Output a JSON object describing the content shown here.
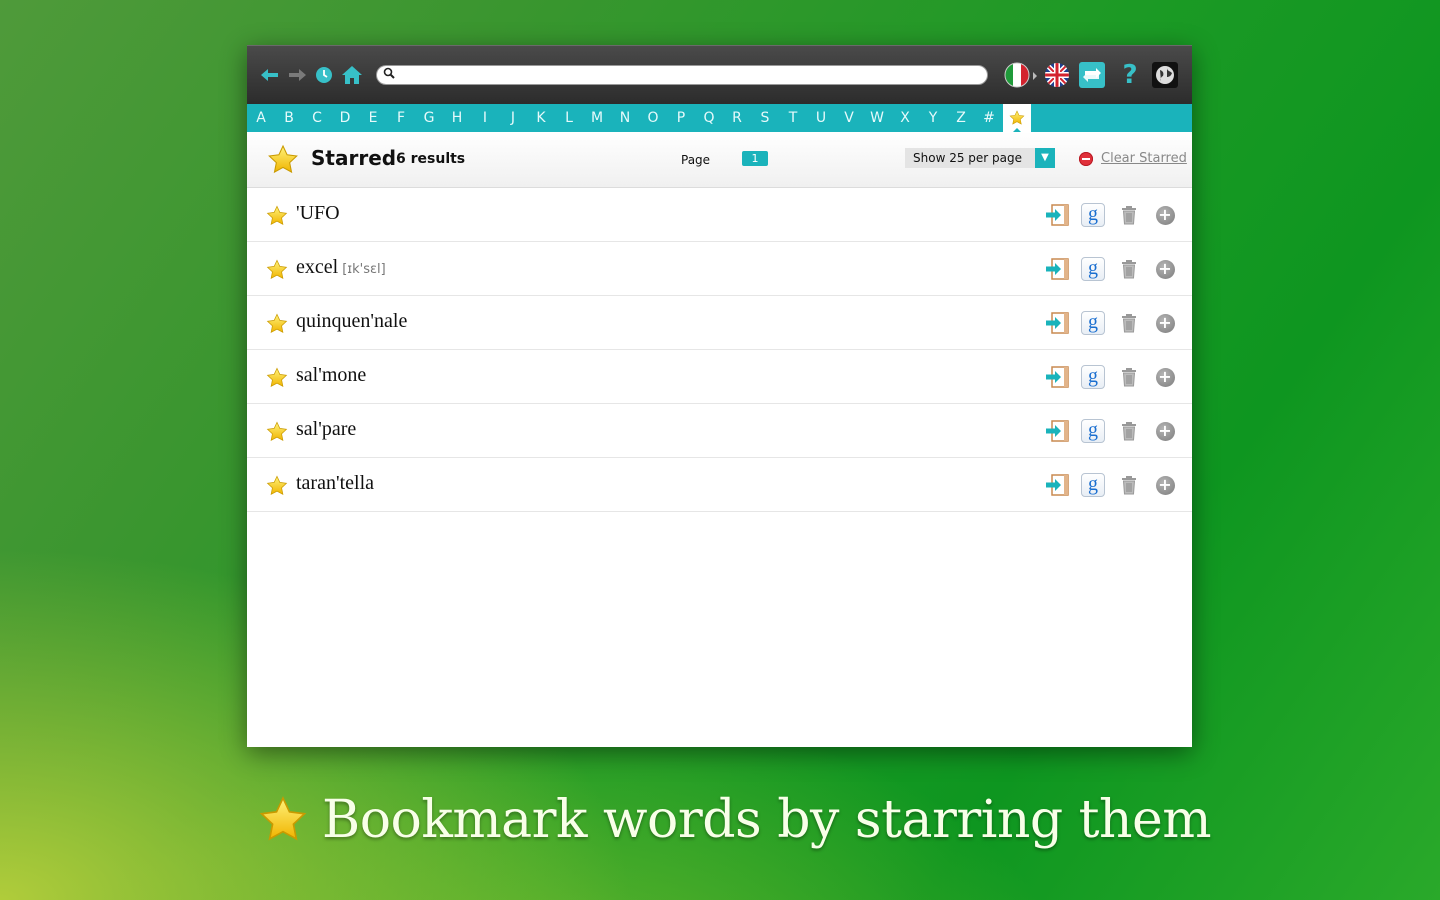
{
  "toolbar": {
    "search": {
      "value": "",
      "placeholder": ""
    },
    "icons": [
      "back-arrow-icon",
      "forward-arrow-icon",
      "history-clock-icon",
      "home-icon",
      "search-icon",
      "italian-flag-icon",
      "uk-flag-icon",
      "swap-languages-icon",
      "help-icon",
      "globe-icon"
    ]
  },
  "alphabet": [
    "A",
    "B",
    "C",
    "D",
    "E",
    "F",
    "G",
    "H",
    "I",
    "J",
    "K",
    "L",
    "M",
    "N",
    "O",
    "P",
    "Q",
    "R",
    "S",
    "T",
    "U",
    "V",
    "W",
    "X",
    "Y",
    "Z",
    "#"
  ],
  "header": {
    "title": "Starred",
    "results": "6 results",
    "page_label": "Page",
    "page_number": "1",
    "per_page": "Show 25 per page",
    "clear_label": "Clear Starred"
  },
  "words": [
    {
      "word": "'UFO",
      "ipa": ""
    },
    {
      "word": "excel",
      "ipa": "[ɪk'sɛl]"
    },
    {
      "word": "quinquen'nale",
      "ipa": ""
    },
    {
      "word": "sal'mone",
      "ipa": ""
    },
    {
      "word": "sal'pare",
      "ipa": ""
    },
    {
      "word": "taran'tella",
      "ipa": ""
    }
  ],
  "caption": "Bookmark words by starring them",
  "colors": {
    "accent": "#1ab3bb",
    "toolbar": "#333333",
    "star": "#f5c518",
    "google_blue": "#1b6fd0"
  }
}
